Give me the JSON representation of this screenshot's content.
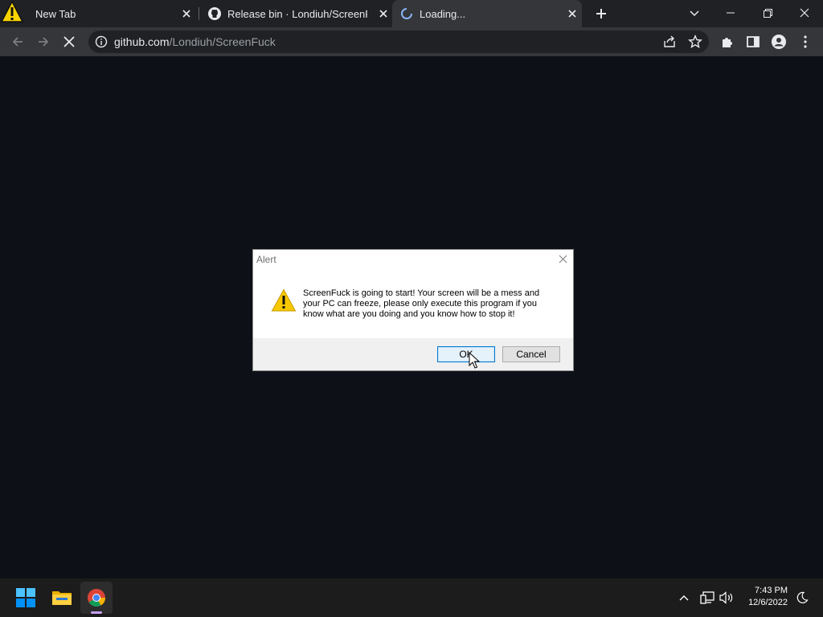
{
  "browser": {
    "tabs": [
      {
        "label": "New Tab",
        "state": "inactive"
      },
      {
        "label": "Release bin · Londiuh/ScreenFuck",
        "state": "inactive"
      },
      {
        "label": "Loading...",
        "state": "active-loading"
      }
    ],
    "url": {
      "host": "github.com",
      "path": "/Londiuh/ScreenFuck"
    }
  },
  "dialog": {
    "title": "Alert",
    "message": "ScreenFuck is going to start! Your screen will be a mess and your PC can freeze, please only execute this program if you know what are you doing and you know how to stop it!",
    "ok_label": "OK",
    "cancel_label": "Cancel"
  },
  "taskbar": {
    "time": "7:43 PM",
    "date": "12/6/2022"
  },
  "colors": {
    "page_background": "#0d1117",
    "warning_yellow": "#f7c800",
    "focus_blue": "#0078d4"
  }
}
